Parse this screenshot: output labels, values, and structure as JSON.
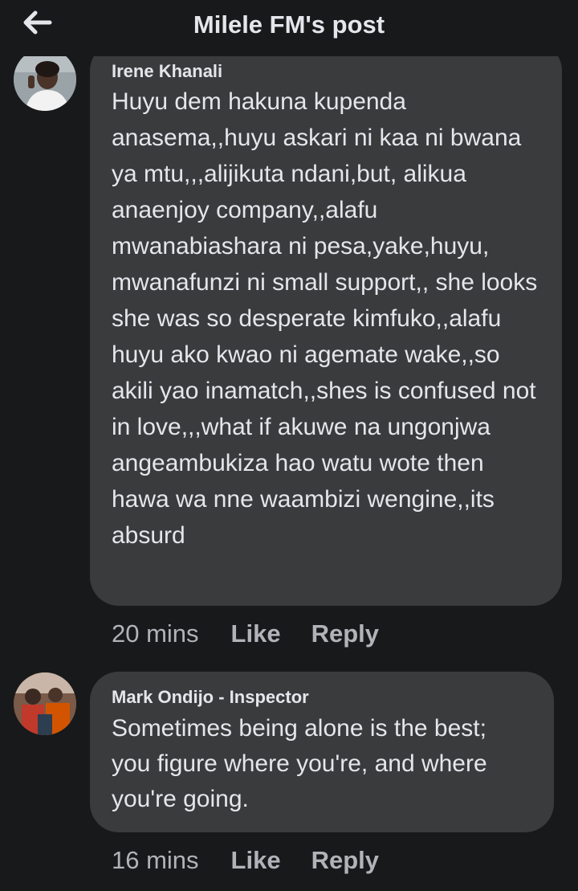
{
  "header": {
    "title": "Milele FM's post",
    "back_icon": "arrow-left-icon"
  },
  "comments": [
    {
      "author": "Irene Khanali",
      "text": "Huyu dem hakuna kupenda anasema,,huyu askari ni kaa ni bwana ya mtu,,,alijikuta ndani,but, alikua anaenjoy company,,alafu mwanabiashara ni pesa,yake,huyu, mwanafunzi ni small support,, she looks she was so desperate kimfuko,,alafu huyu ako kwao ni agemate wake,,so akili yao inamatch,,shes is confused not in love,,,what if akuwe na ungonjwa angeambukiza hao watu wote then hawa wa nne waambizi wengine,,its absurd",
      "time": "20 mins",
      "like": "Like",
      "reply": "Reply"
    },
    {
      "author": "Mark Ondijo - Inspector",
      "text": "Sometimes being alone is the best; you figure where you're, and where you're going.",
      "time": "16 mins",
      "like": "Like",
      "reply": "Reply"
    }
  ],
  "colors": {
    "background": "#18191a",
    "bubble": "#3a3b3c",
    "text": "#e4e6eb",
    "secondary": "#b0b3b8"
  }
}
